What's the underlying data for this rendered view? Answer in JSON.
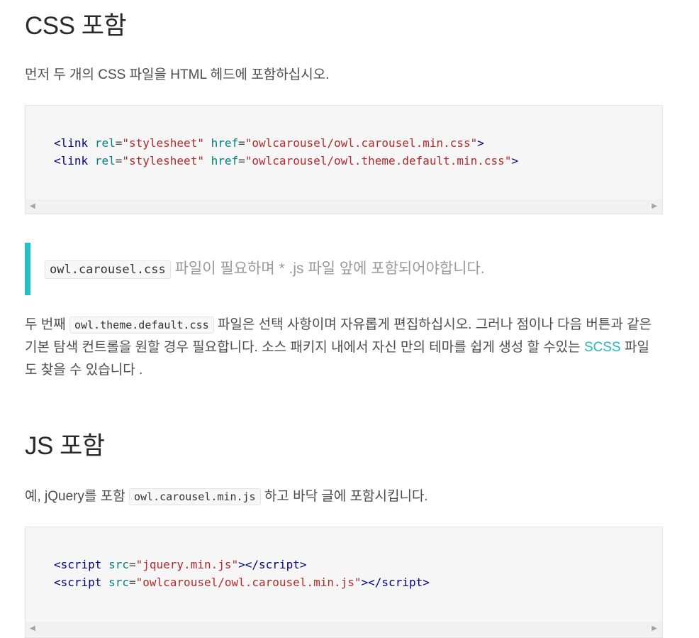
{
  "css_section": {
    "heading": "CSS 포함",
    "intro": "먼저 두 개의 CSS 파일을 HTML 헤드에 포함하십시오.",
    "code_lines": [
      {
        "tag": "link",
        "attr1": "rel",
        "val1": "\"stylesheet\"",
        "attr2": "href",
        "val2": "\"owlcarousel/owl.carousel.min.css\""
      },
      {
        "tag": "link",
        "attr1": "rel",
        "val1": "\"stylesheet\"",
        "attr2": "href",
        "val2": "\"owlcarousel/owl.theme.default.min.css\""
      }
    ],
    "callout": {
      "code": "owl.carousel.css",
      "text": " 파일이 필요하며 * .js 파일 앞에 포함되어야합니다."
    },
    "para": {
      "before": "두 번째 ",
      "code": "owl.theme.default.css",
      "middle": " 파일은 선택 사항이며 자유롭게 편집하십시오. 그러나 점이나 다음 버튼과 같은 기본 탐색 컨트롤을 원할 경우 필요합니다. 소스 패키지 내에서 자신 만의 테마를 쉽게 생성 할 수있는 ",
      "link": "SCSS",
      "after": " 파일 도 찾을 수 있습니다 ."
    }
  },
  "js_section": {
    "heading": "JS 포함",
    "intro": {
      "before": "예, jQuery를 포함 ",
      "code": "owl.carousel.min.js",
      "after": " 하고 바닥 글에 포함시킵니다."
    },
    "code_lines": [
      {
        "tag": "script",
        "attr1": "src",
        "val1": "\"jquery.min.js\""
      },
      {
        "tag": "script",
        "attr1": "src",
        "val1": "\"owlcarousel/owl.carousel.min.js\""
      }
    ]
  },
  "scroll": {
    "left_arrow": "◀",
    "right_arrow": "▶"
  },
  "colors": {
    "accent": "#23c0c8",
    "tag": "#000080",
    "attr": "#008080",
    "string": "#b22a2a"
  }
}
